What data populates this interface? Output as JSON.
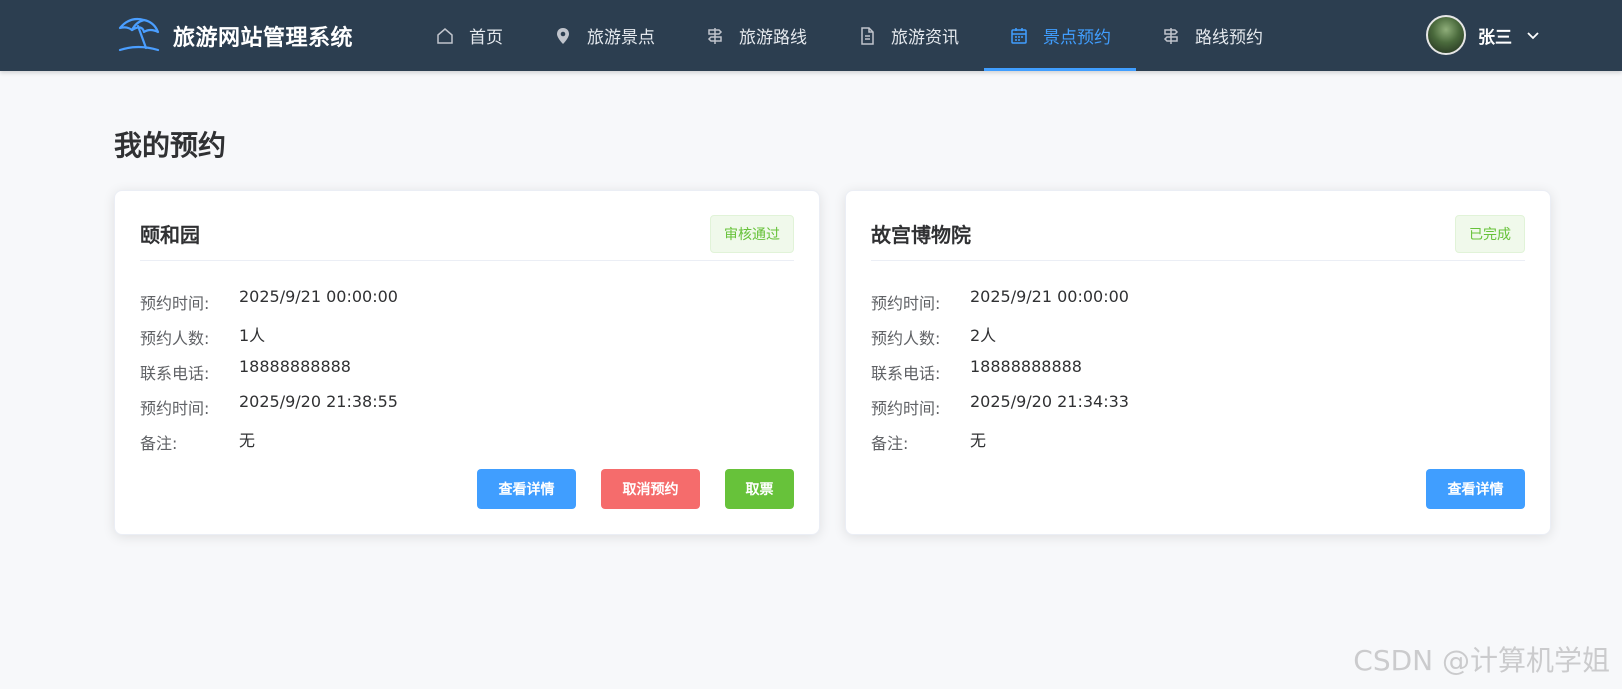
{
  "brand": {
    "title": "旅游网站管理系统",
    "icon": "beach-umbrella-icon"
  },
  "nav": [
    {
      "label": "首页",
      "icon": "home-icon",
      "active": false
    },
    {
      "label": "旅游景点",
      "icon": "location-pin-icon",
      "active": false
    },
    {
      "label": "旅游路线",
      "icon": "route-sign-icon",
      "active": false
    },
    {
      "label": "旅游资讯",
      "icon": "document-icon",
      "active": false
    },
    {
      "label": "景点预约",
      "icon": "calendar-icon",
      "active": true
    },
    {
      "label": "路线预约",
      "icon": "route-sign-icon",
      "active": false
    }
  ],
  "user": {
    "name": "张三"
  },
  "page": {
    "title": "我的预约"
  },
  "cards": [
    {
      "name": "颐和园",
      "status": "审核通过",
      "rows": [
        {
          "label": "预约时间:",
          "value": "2025/9/21 00:00:00"
        },
        {
          "label": "预约人数:",
          "value": "1人"
        },
        {
          "label": "联系电话:",
          "value": "18888888888"
        },
        {
          "label": "预约时间:",
          "value": "2025/9/20 21:38:55"
        },
        {
          "label": "备注:",
          "value": "无"
        }
      ],
      "actions": {
        "detail": "查看详情",
        "cancel": "取消预约",
        "ticket": "取票"
      }
    },
    {
      "name": "故宫博物院",
      "status": "已完成",
      "rows": [
        {
          "label": "预约时间:",
          "value": "2025/9/21 00:00:00"
        },
        {
          "label": "预约人数:",
          "value": "2人"
        },
        {
          "label": "联系电话:",
          "value": "18888888888"
        },
        {
          "label": "预约时间:",
          "value": "2025/9/20 21:34:33"
        },
        {
          "label": "备注:",
          "value": "无"
        }
      ],
      "actions": {
        "detail": "查看详情"
      }
    }
  ],
  "watermark": "CSDN @计算机学姐",
  "colors": {
    "navbar": "#2c3e50",
    "accent": "#409eff",
    "danger": "#f56c6c",
    "success": "#67c23a"
  }
}
